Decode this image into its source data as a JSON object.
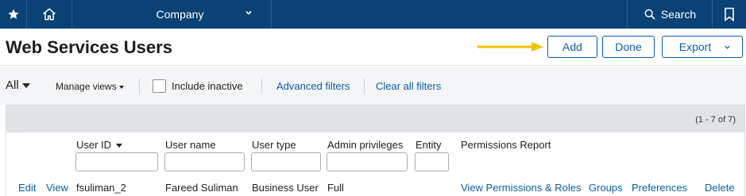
{
  "topbar": {
    "company_label": "Company",
    "search_label": "Search"
  },
  "header": {
    "title": "Web Services Users",
    "buttons": {
      "add": "Add",
      "done": "Done",
      "export": "Export"
    },
    "highlight_arrow_color": "#f2c200"
  },
  "filters": {
    "view": "All",
    "manage_views": "Manage views",
    "include_inactive": "Include inactive",
    "include_inactive_checked": false,
    "advanced_filters": "Advanced filters",
    "clear_all_filters": "Clear all filters"
  },
  "table": {
    "record_count": "(1 - 7 of 7)",
    "columns": {
      "user_id": "User ID",
      "user_name": "User name",
      "user_type": "User type",
      "admin_privileges": "Admin privileges",
      "entity": "Entity",
      "permissions_report": "Permissions Report"
    },
    "rows": [
      {
        "edit": "Edit",
        "view": "View",
        "user_id": "fsuliman_2",
        "user_name": "Fareed Suliman",
        "user_type": "Business User",
        "admin_privileges": "Full",
        "view_permissions": "View Permissions & Roles",
        "groups": "Groups",
        "preferences": "Preferences",
        "delete": "Delete"
      }
    ]
  },
  "colors": {
    "nav_bg": "#0a4275",
    "link": "#0a5fa8",
    "filter_bg": "#f4f5f6",
    "table_header_bg": "#dfe3e6"
  }
}
